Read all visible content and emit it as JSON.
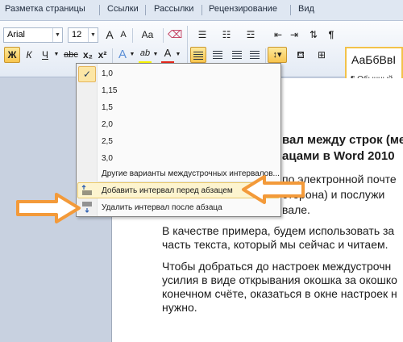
{
  "ribbon_tabs": [
    "Разметка страницы",
    "Ссылки",
    "Рассылки",
    "Рецензирование",
    "Вид"
  ],
  "font": {
    "name": "Arial",
    "size": "12"
  },
  "toolbar": {
    "grow_font": "A",
    "shrink_font": "A",
    "change_case": "Aa",
    "bold": "Ж",
    "italic": "К",
    "strikethrough": "abc",
    "subscript": "x₂",
    "superscript": "x²",
    "text_effects": "A",
    "highlight": "ab",
    "font_color": "A",
    "pilcrow": "¶"
  },
  "styles": {
    "sample": "АаБбВвI",
    "name": "¶ Обычный"
  },
  "line_spacing_menu": {
    "selected": "1,0",
    "options": [
      "1,0",
      "1,15",
      "1,5",
      "2,0",
      "2,5",
      "3,0"
    ],
    "other_options": "Другие варианты междустрочных интервалов...",
    "add_before": "Добавить интервал перед абзацем",
    "remove_after": "Удалить интервал после абзаца"
  },
  "document": {
    "heading_line1": "вал между строк (ме",
    "heading_line2": "ацами в Word 2010",
    "para1_line1": "по электронной почте",
    "para1_line2": "сторона) и послужи",
    "para1_line3": "вале.",
    "para2_line1": "В качестве примера, будем использовать за",
    "para2_line2": "часть текста, который мы сейчас и читаем.",
    "para3_line1": "Чтобы добраться до настроек междустрочн",
    "para3_line2": "усилия в виде открывания окошка за окошко",
    "para3_line3": "конечном счёте, оказаться в окне настроек н",
    "para3_line4": "нужно."
  },
  "colors": {
    "annotation_arrow": "#f39a3a",
    "highlight_button": "#f8c54f",
    "font_color_bar": "#e3261b",
    "highlighter_bar": "#f6f300"
  }
}
